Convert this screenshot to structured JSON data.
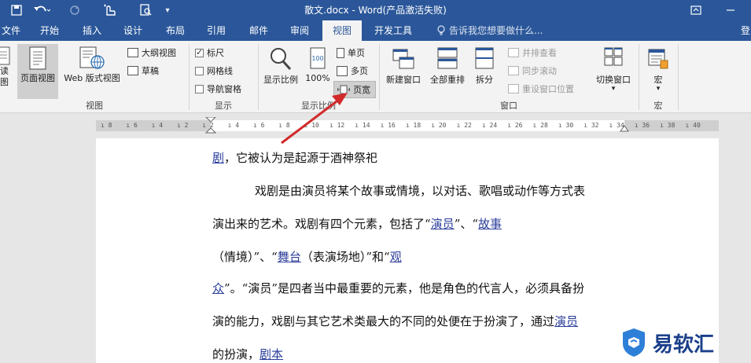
{
  "titlebar": {
    "title": "散文.docx - Word(产品激活失败)"
  },
  "tabs": [
    {
      "label": "文件"
    },
    {
      "label": "开始"
    },
    {
      "label": "插入"
    },
    {
      "label": "设计"
    },
    {
      "label": "布局"
    },
    {
      "label": "引用"
    },
    {
      "label": "邮件"
    },
    {
      "label": "审阅"
    },
    {
      "label": "视图"
    },
    {
      "label": "开发工具"
    }
  ],
  "tell_me": "告诉我您想要做什么...",
  "login": "登",
  "ribbon": {
    "views": {
      "read_mode": "读\n图",
      "print_layout": "页面视图",
      "web_layout": "Web 版式视图",
      "outline": "大纲视图",
      "draft": "草稿",
      "group": "视图"
    },
    "show": {
      "ruler": "标尺",
      "gridlines": "网格线",
      "nav_pane": "导航窗格",
      "group": "显示"
    },
    "zoom": {
      "zoom": "显示比例",
      "percent": "100%",
      "one_page": "单页",
      "multi_page": "多页",
      "page_width": "页宽",
      "group": "显示比例"
    },
    "window": {
      "new_window": "新建窗口",
      "arrange_all": "全部重排",
      "split": "拆分",
      "side_by_side": "并排查看",
      "sync_scroll": "同步滚动",
      "reset_pos": "重设窗口位置",
      "switch": "切换窗口",
      "group": "窗口"
    },
    "macros": {
      "macros": "宏",
      "group": "宏"
    }
  },
  "ruler_ticks": [
    "8",
    "6",
    "4",
    "2",
    "2",
    "4",
    "6",
    "8",
    "10",
    "12",
    "14",
    "16",
    "18",
    "20",
    "22",
    "24",
    "26",
    "28",
    "30",
    "32",
    "34",
    "36",
    "38",
    "40"
  ],
  "document": {
    "l1_link": "剧",
    "l1_text": "，它被认为是起源于酒神祭祀",
    "l2_text": "戏剧是由演员将某个故事或情境，以对话、歌唱或动作等方式表",
    "l3_text": "演出来的艺术。戏剧有四个元素，包括了“",
    "l3_link1": "演员",
    "l3_mid": "”、“",
    "l3_link2": "故事",
    "l4_pre": "（情境）”、“",
    "l4_link1": "舞台",
    "l4_mid": "（表演场地）”和“",
    "l4_link2": "观",
    "l5_link": "众",
    "l5_text": "”。“演员”是四者当中最重要的元素，他是角色的代言人，必须具备扮",
    "l6_text": "演的能力，戏剧与其它艺术类最大的不同的处便在于扮演了，通过",
    "l6_link": "演员",
    "l7_text": "的扮演，",
    "l7_link": "剧本"
  },
  "watermark": {
    "text": "易软汇",
    "color": "#1b3f8a"
  },
  "colors": {
    "accent": "#2b579a",
    "arrow": "#d22a2a",
    "link": "#2b3d9a"
  }
}
